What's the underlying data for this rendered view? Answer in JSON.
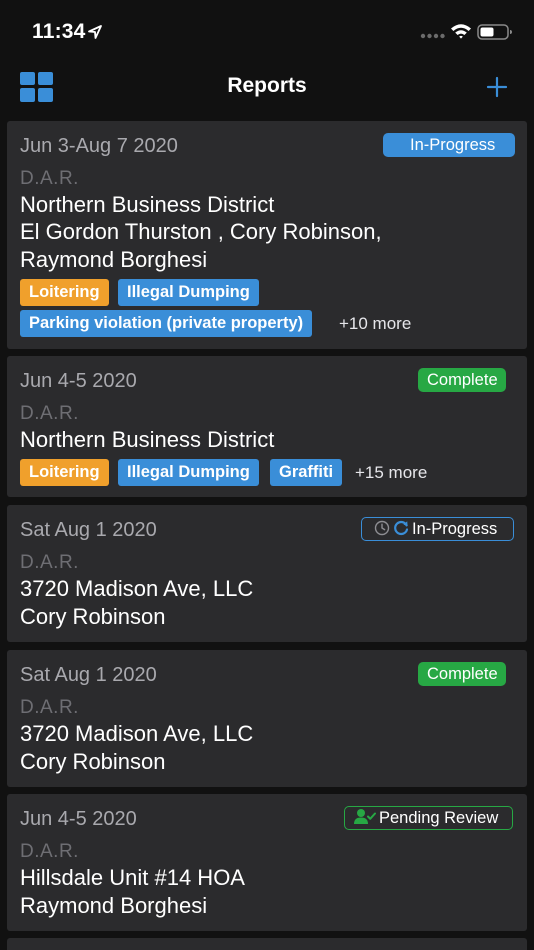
{
  "status_bar": {
    "time": "11:34"
  },
  "nav": {
    "title": "Reports"
  },
  "colors": {
    "accent_blue": "#3a8ed8",
    "complete_green": "#27a844",
    "tag_orange": "#f0a02c"
  },
  "reports": [
    {
      "date": "Jun 3-Aug 7 2020",
      "type": "D.A.R.",
      "status": "In-Progress",
      "lines": [
        "Northern Business District",
        "El Gordon Thurston , Cory Robinson,",
        "Raymond Borghesi"
      ],
      "tags": [
        "Loitering",
        "Illegal Dumping",
        "Parking violation (private property)"
      ],
      "more": "+10 more"
    },
    {
      "date": "Jun 4-5 2020",
      "type": "D.A.R.",
      "status": "Complete",
      "lines": [
        "Northern Business District"
      ],
      "tags": [
        "Loitering",
        "Illegal Dumping",
        "Graffiti"
      ],
      "more": "+15 more"
    },
    {
      "date": "Sat Aug 1 2020",
      "type": "D.A.R.",
      "status": "In-Progress",
      "lines": [
        "3720 Madison Ave, LLC",
        "Cory Robinson"
      ]
    },
    {
      "date": "Sat Aug 1 2020",
      "type": "D.A.R.",
      "status": "Complete",
      "lines": [
        "3720 Madison Ave, LLC",
        "Cory Robinson"
      ]
    },
    {
      "date": "Jun 4-5 2020",
      "type": "D.A.R.",
      "status": "Pending Review",
      "lines": [
        "Hillsdale Unit #14 HOA",
        "Raymond Borghesi"
      ]
    }
  ]
}
